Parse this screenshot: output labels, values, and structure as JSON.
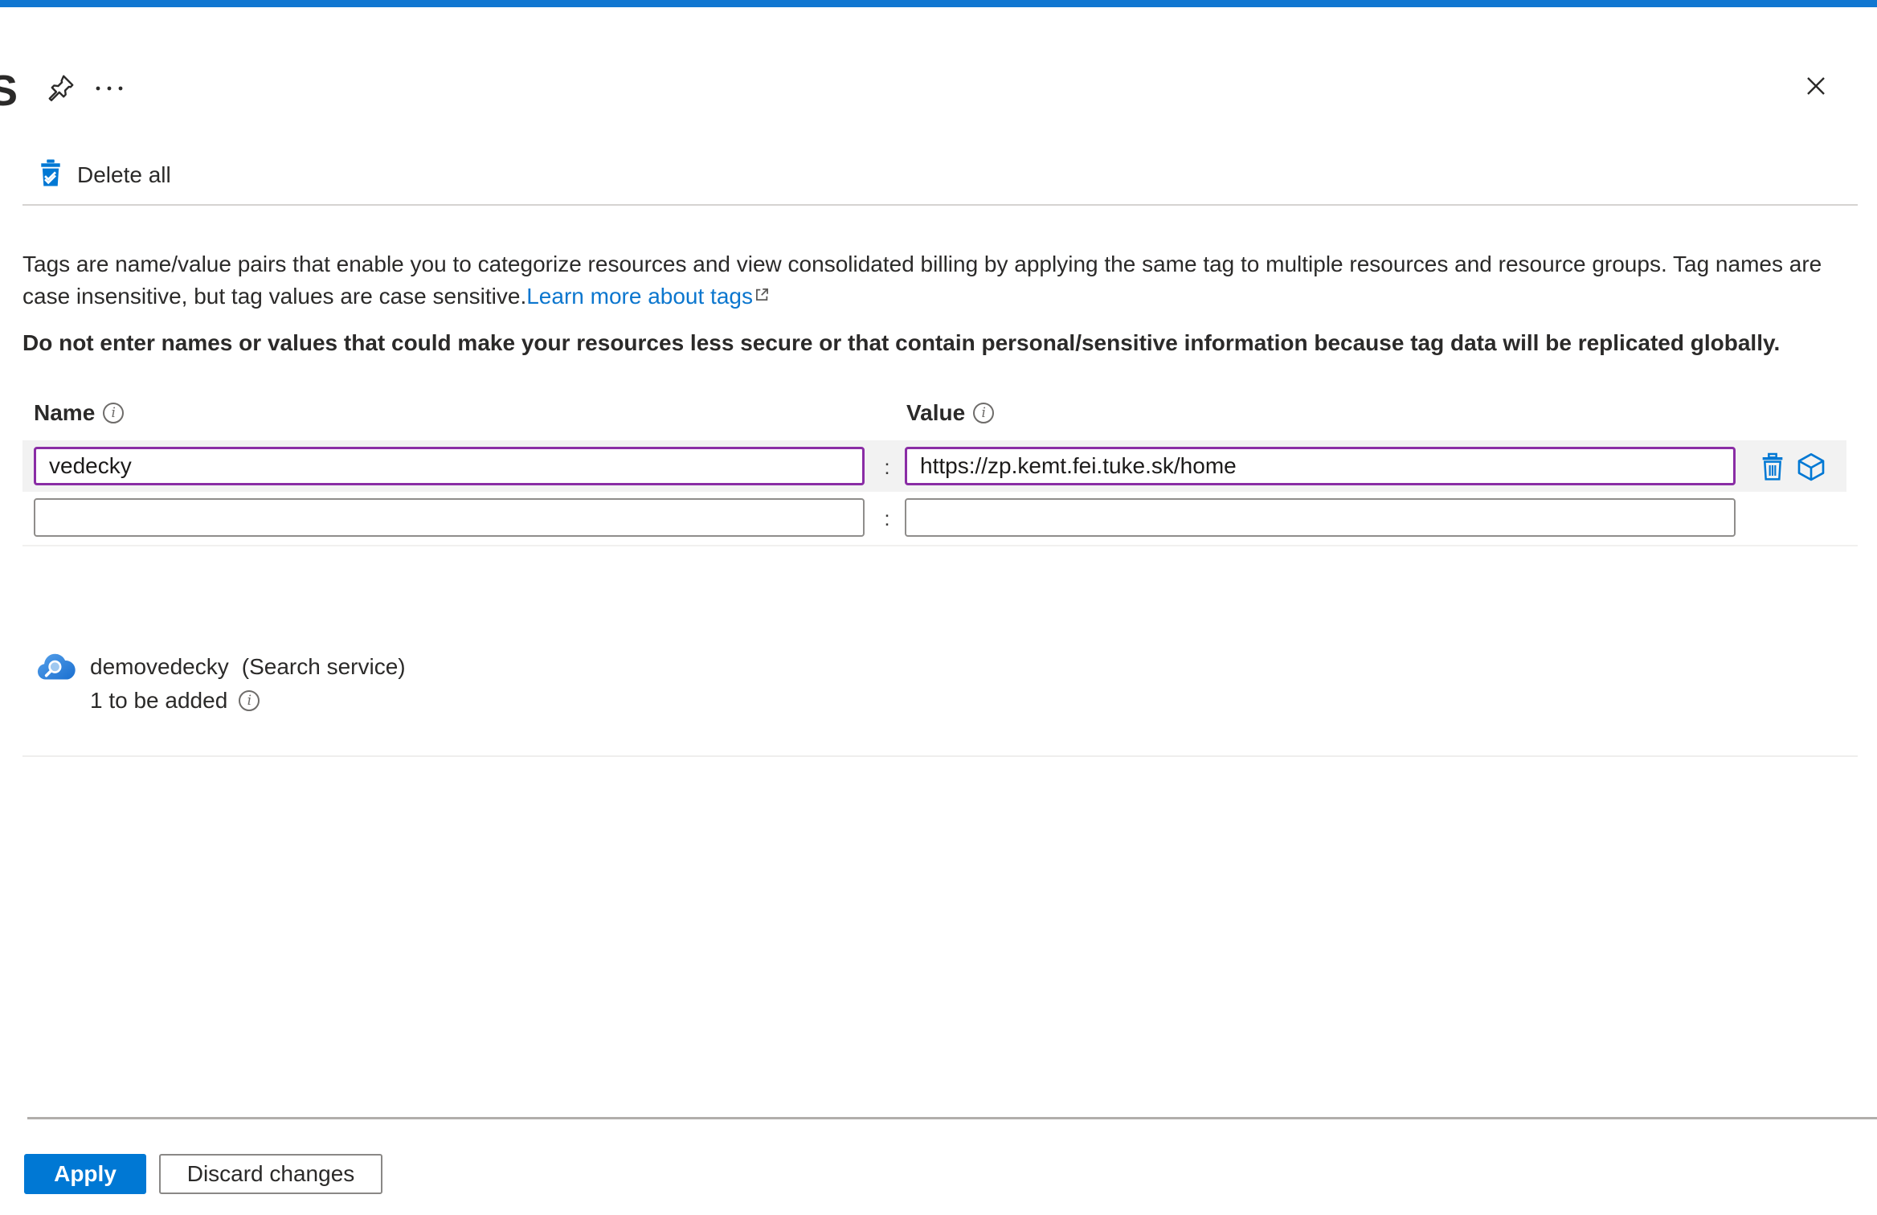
{
  "window": {
    "partial_title": "S"
  },
  "toolbar": {
    "delete_all_label": "Delete all"
  },
  "description": {
    "body": "Tags are name/value pairs that enable you to categorize resources and view consolidated billing by applying the same tag to multiple resources and resource groups. Tag names are case insensitive, but tag values are case sensitive.",
    "link_label": "Learn more about tags",
    "warning": "Do not enter names or values that could make your resources less secure or that contain personal/sensitive information because tag data will be replicated globally."
  },
  "tags": {
    "name_header": "Name",
    "value_header": "Value",
    "separator": ":",
    "rows": [
      {
        "name": "vedecky",
        "value": "https://zp.kemt.fei.tuke.sk/home"
      },
      {
        "name": "",
        "value": ""
      }
    ]
  },
  "resource": {
    "name": "demovedecky",
    "type_label": "(Search service)",
    "status": "1 to be added"
  },
  "footer": {
    "apply_label": "Apply",
    "discard_label": "Discard changes"
  },
  "colors": {
    "accent_blue": "#0078d4",
    "modified_purple": "#8a2da5",
    "top_bar_blue": "#1177d1",
    "row_band_gray": "#f2f2f2"
  }
}
